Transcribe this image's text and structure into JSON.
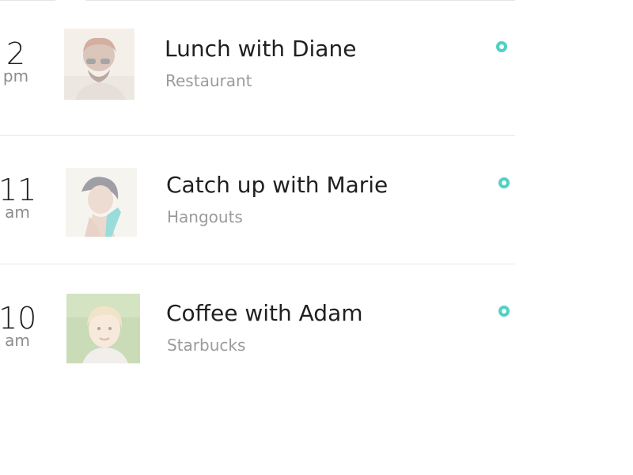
{
  "events": [
    {
      "hour": "2",
      "period": "pm",
      "title": "Lunch with Diane",
      "location": "Restaurant",
      "avatar_icon": "avatar-photo",
      "status_color": "#4fd1c5"
    },
    {
      "hour": "11",
      "period": "am",
      "title": "Catch up with Marie",
      "location": "Hangouts",
      "avatar_icon": "avatar-photo",
      "status_color": "#4fd1c5"
    },
    {
      "hour": "10",
      "period": "am",
      "title": "Coffee with Adam",
      "location": "Starbucks",
      "avatar_icon": "avatar-photo",
      "status_color": "#4fd1c5"
    }
  ],
  "colors": {
    "accent": "#4fd1c5",
    "title_text": "#202020",
    "subtitle_text": "#9b9b9b",
    "divider": "#e8e8e8"
  }
}
